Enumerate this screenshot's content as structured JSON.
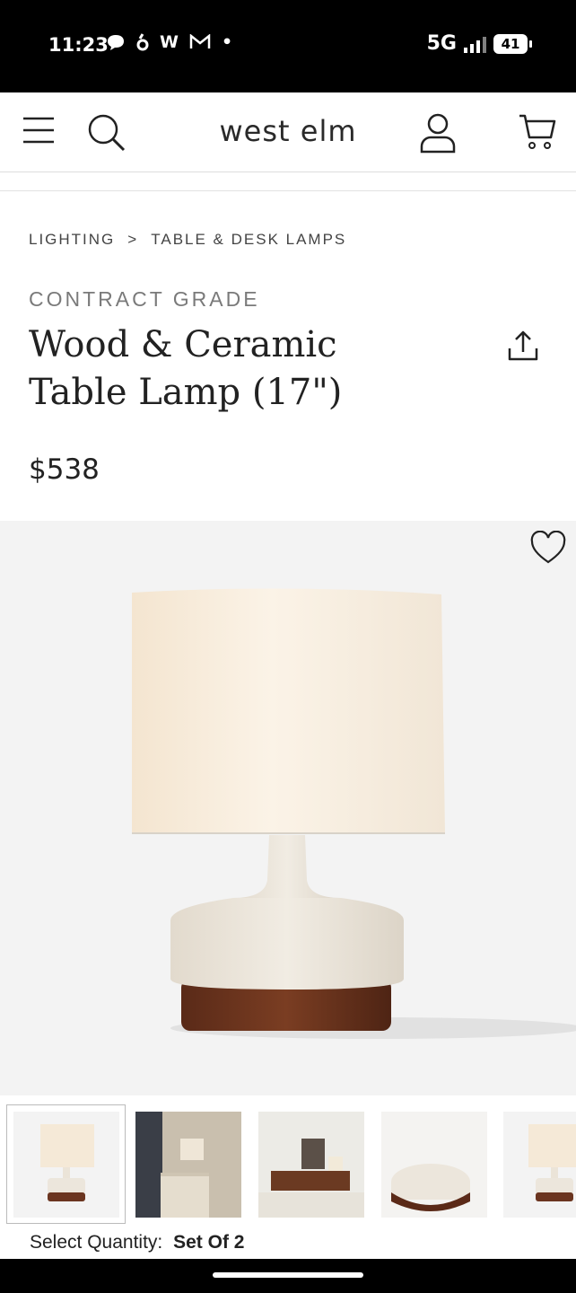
{
  "status_bar": {
    "time": "11:23",
    "network": "5G",
    "battery": "41"
  },
  "header": {
    "logo": "west elm"
  },
  "breadcrumb": {
    "items": [
      "LIGHTING",
      "TABLE & DESK LAMPS"
    ],
    "separator": ">"
  },
  "product": {
    "eyebrow": "CONTRACT GRADE",
    "title": "Wood & Ceramic Table Lamp (17\")",
    "price": "$538",
    "quantity_label": "Select Quantity:",
    "quantity_value": "Set Of 2"
  },
  "colors": {
    "shade": "#f7eee2",
    "ceramic": "#ece7df",
    "wood": "#6b3520",
    "background": "#f3f3f3"
  },
  "icons": [
    "menu-icon",
    "search-icon",
    "account-icon",
    "cart-icon",
    "share-icon",
    "heart-icon"
  ]
}
